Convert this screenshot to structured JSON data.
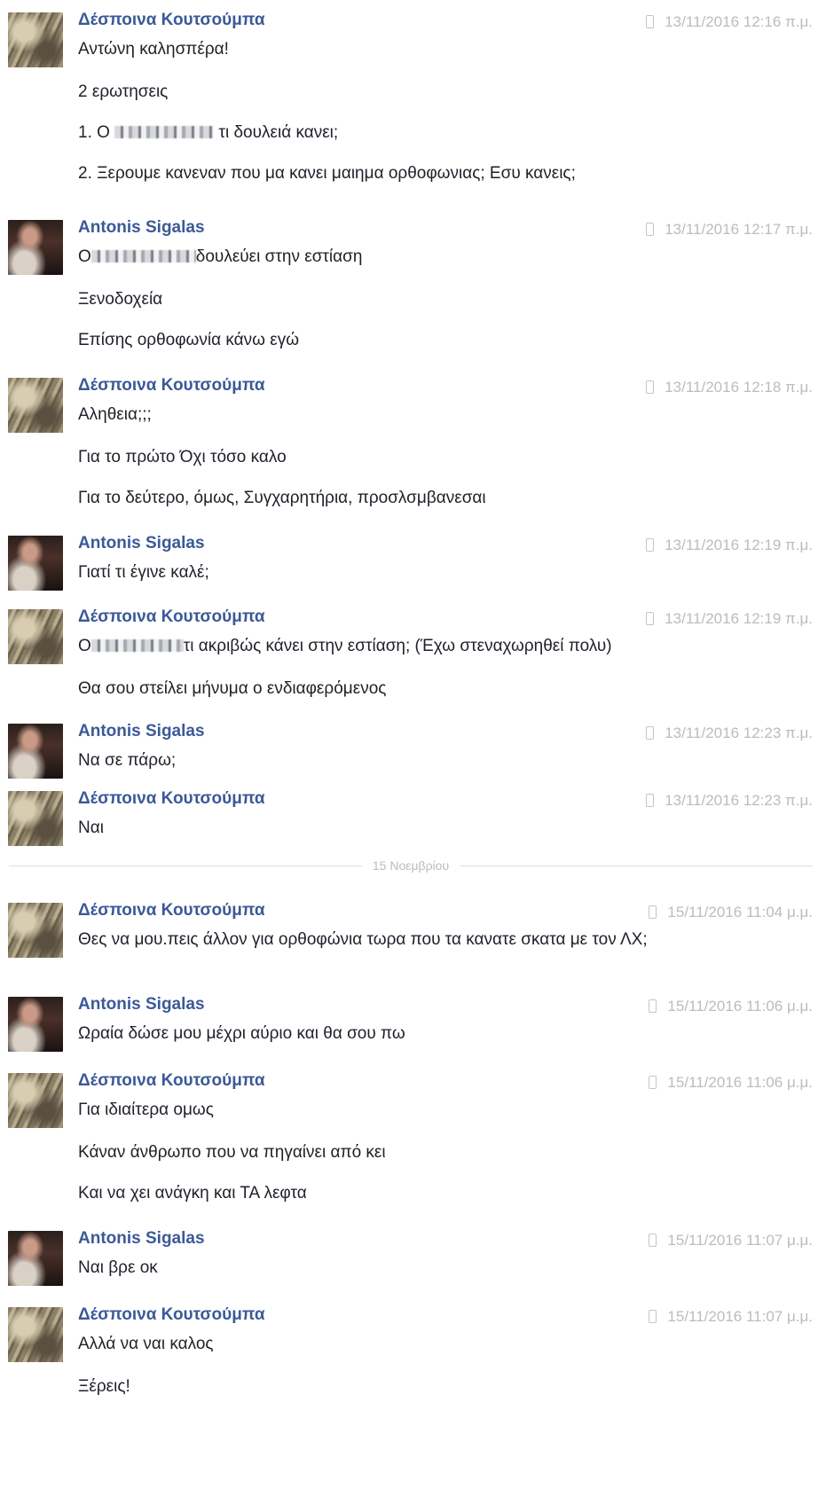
{
  "conversation": {
    "date_divider": "15 Νοεμβρίου",
    "groups": [
      {
        "sender": "Δέσποινα Κουτσούμπα",
        "time": "13/11/2016 12:16 π.μ.",
        "messages": [
          "Αντώνη καλησπέρα!",
          "2 ερωτησεις",
          "1. Ο",
          "τι δουλειά κανει;",
          "2. Ξερουμε κανεναν που μα κανει μαιημα ορθοφωνιας; Εσυ κανεις;"
        ]
      },
      {
        "sender": "Antonis Sigalas",
        "time": "13/11/2016 12:17 π.μ.",
        "messages": [
          "Ο",
          "δουλεύει στην εστίαση",
          "Ξενοδοχεία",
          "Επίσης ορθοφωνία κάνω εγώ"
        ]
      },
      {
        "sender": "Δέσποινα Κουτσούμπα",
        "time": "13/11/2016 12:18 π.μ.",
        "messages": [
          "Αληθεια;;;",
          "Για το πρώτο Όχι τόσο καλο",
          "Για το δεύτερο, όμως, Συγχαρητήρια, προσλσμβανεσαι"
        ]
      },
      {
        "sender": "Antonis Sigalas",
        "time": "13/11/2016 12:19 π.μ.",
        "messages": [
          "Γιατί τι έγινε καλέ;"
        ]
      },
      {
        "sender": "Δέσποινα Κουτσούμπα",
        "time": "13/11/2016 12:19 π.μ.",
        "messages": [
          "Ο",
          "τι ακριβώς κάνει στην εστίαση; (Έχω στεναχωρηθεί πολυ)",
          "Θα σου στείλει μήνυμα ο ενδιαφερόμενος"
        ]
      },
      {
        "sender": "Antonis Sigalas",
        "time": "13/11/2016 12:23 π.μ.",
        "messages": [
          "Να σε πάρω;"
        ]
      },
      {
        "sender": "Δέσποινα Κουτσούμπα",
        "time": "13/11/2016 12:23 π.μ.",
        "messages": [
          "Ναι"
        ]
      },
      {
        "sender": "Δέσποινα Κουτσούμπα",
        "time": "15/11/2016 11:04 μ.μ.",
        "messages": [
          "Θες να μου.πεις άλλον για ορθοφώνια τωρα που τα κανατε σκατα με τον ΛΧ;"
        ]
      },
      {
        "sender": "Antonis Sigalas",
        "time": "15/11/2016 11:06 μ.μ.",
        "messages": [
          "Ωραία δώσε μου μέχρι αύριο και θα σου πω"
        ]
      },
      {
        "sender": "Δέσποινα Κουτσούμπα",
        "time": "15/11/2016 11:06 μ.μ.",
        "messages": [
          "Για ιδιαίτερα ομως",
          "Κάναν άνθρωπο που να πηγαίνει από κει",
          "Και να χει ανάγκη και ΤΑ λεφτα"
        ]
      },
      {
        "sender": "Antonis Sigalas",
        "time": "15/11/2016 11:07 μ.μ.",
        "messages": [
          "Ναι βρε οκ"
        ]
      },
      {
        "sender": "Δέσποινα Κουτσούμπα",
        "time": "15/11/2016 11:07 μ.μ.",
        "messages": [
          "Αλλά να ναι καλος",
          "Ξέρεις!"
        ]
      }
    ]
  }
}
